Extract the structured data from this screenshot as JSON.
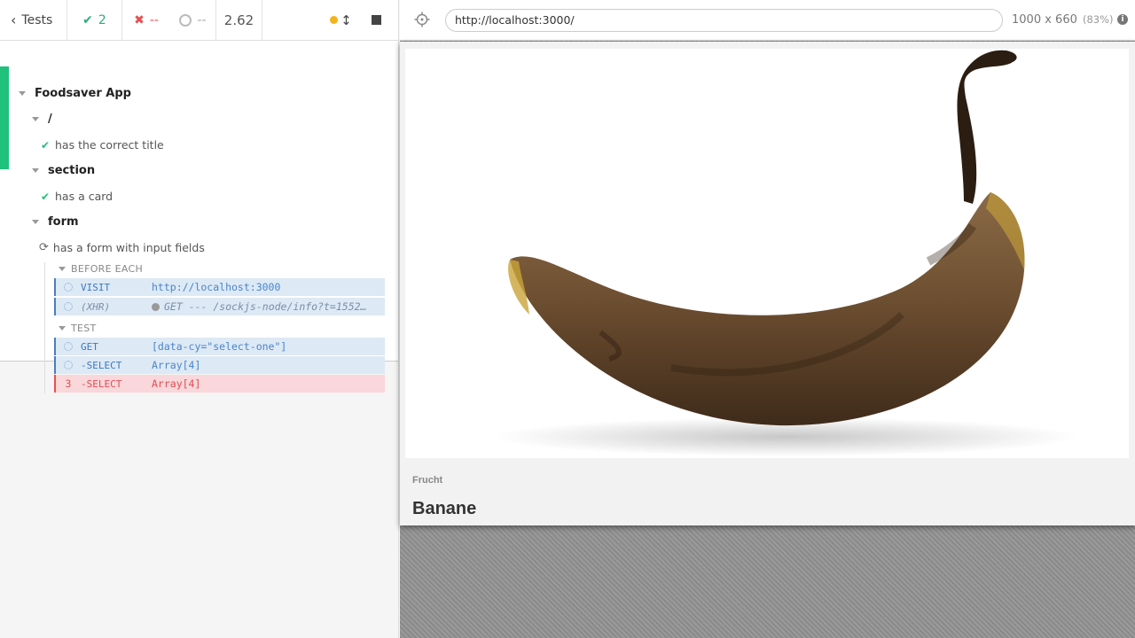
{
  "stats": {
    "tests_label": "Tests",
    "passed": "2",
    "failed": "--",
    "pending": "--",
    "duration": "2.62"
  },
  "runnables": {
    "root_suite": "Foodsaver App",
    "suite_root": "/",
    "test_title": "has the correct title",
    "suite_section": "section",
    "test_card": "has a card",
    "suite_form": "form",
    "test_form": "has a form with input fields",
    "before_each": "BEFORE EACH",
    "test_header": "TEST",
    "commands": [
      {
        "num": "",
        "name": "VISIT",
        "message": "http://localhost:3000",
        "state": "pending"
      },
      {
        "num": "",
        "name": "(XHR)",
        "message": "GET --- /sockjs-node/info?t=1552…",
        "state": "xhr"
      },
      {
        "num": "",
        "name": "GET",
        "message": "[data-cy=\"select-one\"]",
        "state": "pending"
      },
      {
        "num": "",
        "name": "-SELECT",
        "message": "Array[4]",
        "state": "pending"
      },
      {
        "num": "3",
        "name": "-SELECT",
        "message": "Array[4]",
        "state": "failed"
      }
    ]
  },
  "aut": {
    "url": "http://localhost:3000/",
    "viewport": "1000 x 660",
    "scale": "(83%)"
  },
  "app": {
    "card_category": "Frucht",
    "card_title": "Banane"
  },
  "colors": {
    "passed": "#1fc17b",
    "failed": "#e94f4f",
    "running": "#f3b31a",
    "command_bg": "#dde9f5"
  }
}
